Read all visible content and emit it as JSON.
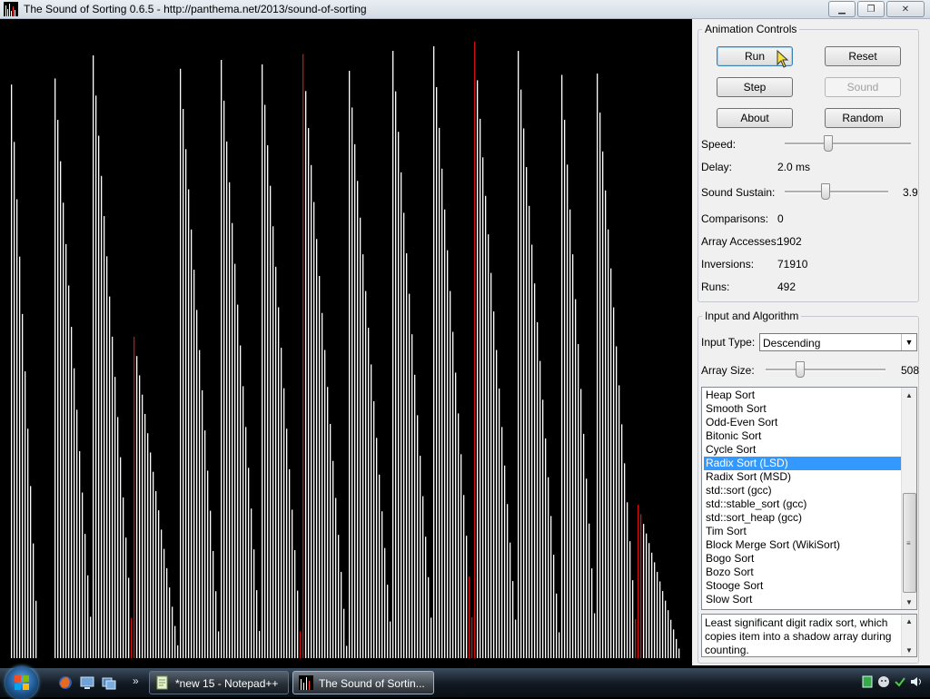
{
  "window": {
    "title": "The Sound of Sorting 0.6.5 - http://panthema.net/2013/sound-of-sorting",
    "controls": [
      "minimize",
      "maximize",
      "close"
    ]
  },
  "visualization": {
    "bar_color": "#ffffff",
    "highlight_color": "#cc1111",
    "background": "#000000",
    "highlight_bars": [
      144,
      330,
      517,
      700
    ]
  },
  "animation_controls": {
    "legend": "Animation Controls",
    "buttons": {
      "run": "Run",
      "reset": "Reset",
      "step": "Step",
      "sound": "Sound",
      "about": "About",
      "random": "Random"
    },
    "speed_label": "Speed:",
    "speed_fraction": 0.33,
    "delay_label": "Delay:",
    "delay_value": "2.0 ms",
    "sustain_label": "Sound Sustain:",
    "sustain_value": "3.9",
    "sustain_fraction": 0.38,
    "stats": {
      "comparisons_label": "Comparisons:",
      "comparisons_value": "0",
      "array_accesses_label": "Array Accesses:",
      "array_accesses_value": "1902",
      "inversions_label": "Inversions:",
      "inversions_value": "71910",
      "runs_label": "Runs:",
      "runs_value": "492"
    }
  },
  "input_algorithm": {
    "legend": "Input and Algorithm",
    "input_type_label": "Input Type:",
    "input_type_value": "Descending",
    "array_size_label": "Array Size:",
    "array_size_value": "508",
    "array_size_fraction": 0.27,
    "algorithms": [
      "Heap Sort",
      "Smooth Sort",
      "Odd-Even Sort",
      "Bitonic Sort",
      "Cycle Sort",
      "Radix Sort (LSD)",
      "Radix Sort (MSD)",
      "std::sort (gcc)",
      "std::stable_sort (gcc)",
      "std::sort_heap (gcc)",
      "Tim Sort",
      "Block Merge Sort (WikiSort)",
      "Bogo Sort",
      "Bozo Sort",
      "Stooge Sort",
      "Slow Sort"
    ],
    "selected_algorithm": "Radix Sort (LSD)",
    "description": "Least significant digit radix sort, which copies item into a shadow array during counting."
  },
  "taskbar": {
    "tasks": [
      {
        "label": "*new 15 - Notepad++",
        "icon": "notepad-icon",
        "active": false
      },
      {
        "label": "The Sound of Sortin...",
        "icon": "sound-of-sorting-icon",
        "active": true
      }
    ],
    "quick_launch": [
      "firefox-icon",
      "show-desktop-icon",
      "switch-windows-icon"
    ],
    "tray_icons": [
      "network-icon",
      "messenger-icon",
      "safely-remove-icon",
      "volume-icon"
    ]
  }
}
